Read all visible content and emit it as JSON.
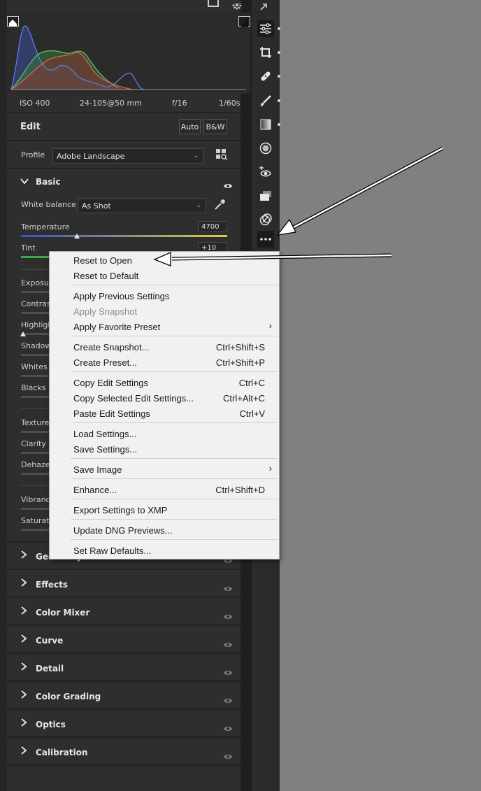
{
  "histogram": {
    "meta": {
      "iso": "ISO 400",
      "lens": "24-105@50 mm",
      "aperture": "f/16",
      "shutter": "1/60s"
    }
  },
  "edit": {
    "title": "Edit",
    "auto_label": "Auto",
    "bw_label": "B&W",
    "profile_label": "Profile",
    "profile_value": "Adobe Landscape"
  },
  "basic": {
    "title": "Basic",
    "white_balance_label": "White balance",
    "white_balance_value": "As Shot",
    "temperature_label": "Temperature",
    "temperature_value": "4700",
    "temperature_position": 0.27,
    "tint_label": "Tint",
    "tint_value": "+10",
    "partial_labels": [
      "Exposur",
      "Contras",
      "Highligh",
      "Shadows",
      "Whites",
      "Blacks",
      "Texture",
      "Clarity",
      "Dehaze",
      "Vibranc",
      "Saturati"
    ]
  },
  "sections": [
    {
      "title": "Geometry"
    },
    {
      "title": "Effects"
    },
    {
      "title": "Color Mixer"
    },
    {
      "title": "Curve"
    },
    {
      "title": "Detail"
    },
    {
      "title": "Color Grading"
    },
    {
      "title": "Optics"
    },
    {
      "title": "Calibration"
    }
  ],
  "toolbar": {
    "tools": [
      "edit-sliders-icon",
      "crop-icon",
      "healing-icon",
      "brush-icon",
      "linear-gradient-icon",
      "radial-gradient-icon",
      "red-eye-icon",
      "snapshots-icon",
      "presets-icon",
      "more-options-icon"
    ]
  },
  "menu": {
    "items": [
      {
        "label": "Reset to Open",
        "shortcut": ""
      },
      {
        "label": "Reset to Default",
        "shortcut": ""
      },
      {
        "label": "Apply Previous Settings",
        "shortcut": ""
      },
      {
        "label": "Apply Snapshot",
        "shortcut": "",
        "disabled": true
      },
      {
        "label": "Apply Favorite Preset",
        "shortcut": "",
        "submenu": true
      },
      {
        "label": "Create Snapshot...",
        "shortcut": "Ctrl+Shift+S"
      },
      {
        "label": "Create Preset...",
        "shortcut": "Ctrl+Shift+P"
      },
      {
        "label": "Copy Edit Settings",
        "shortcut": "Ctrl+C"
      },
      {
        "label": "Copy Selected Edit Settings...",
        "shortcut": "Ctrl+Alt+C"
      },
      {
        "label": "Paste Edit Settings",
        "shortcut": "Ctrl+V"
      },
      {
        "label": "Load Settings...",
        "shortcut": ""
      },
      {
        "label": "Save Settings...",
        "shortcut": ""
      },
      {
        "label": "Save Image",
        "shortcut": "",
        "submenu": true
      },
      {
        "label": "Enhance...",
        "shortcut": "Ctrl+Shift+D"
      },
      {
        "label": "Export Settings to XMP",
        "shortcut": ""
      },
      {
        "label": "Update DNG Previews...",
        "shortcut": ""
      },
      {
        "label": "Set Raw Defaults...",
        "shortcut": ""
      }
    ],
    "submenu_glyph": "›"
  },
  "colors": {
    "panel_bg": "#2e2e2e",
    "canvas_bg": "#808080",
    "menu_bg": "#f1f1f1",
    "toolbar_bg": "#2b2b2b"
  }
}
